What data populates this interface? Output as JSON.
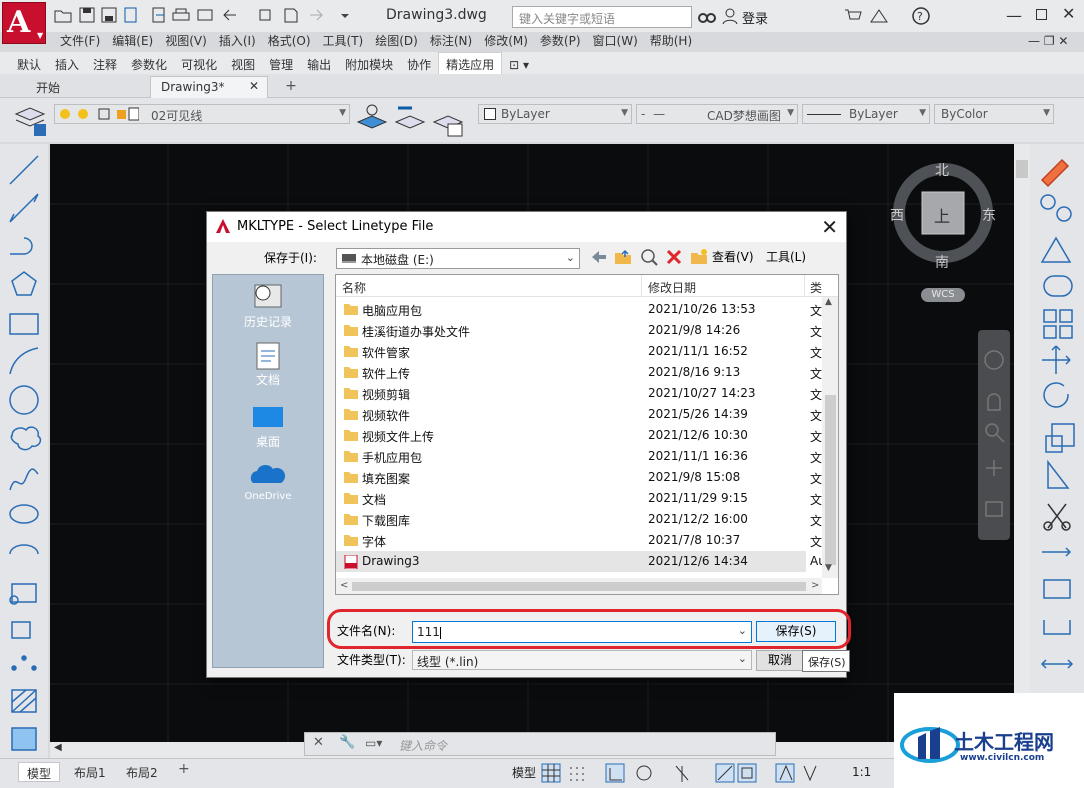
{
  "app": {
    "logo_letter": "A",
    "doc_title": "Drawing3.dwg",
    "search_placeholder": "键入关键字或短语",
    "login": "登录"
  },
  "menu": [
    "文件(F)",
    "编辑(E)",
    "视图(V)",
    "插入(I)",
    "格式(O)",
    "工具(T)",
    "绘图(D)",
    "标注(N)",
    "修改(M)",
    "参数(P)",
    "窗口(W)",
    "帮助(H)"
  ],
  "ribbon_tabs": [
    "默认",
    "插入",
    "注释",
    "参数化",
    "可视化",
    "视图",
    "管理",
    "输出",
    "附加模块",
    "协作",
    "精选应用"
  ],
  "ribbon_selected": "精选应用",
  "doc_tabs": {
    "start": "开始",
    "drawing": "Drawing3*",
    "add": "+"
  },
  "properties": {
    "layer": "02可见线",
    "color": "ByLayer",
    "linetype": "CAD梦想画图",
    "lineweight": "ByLayer",
    "plotstyle": "ByColor"
  },
  "viewcube": {
    "north": "北",
    "south": "南",
    "west": "西",
    "east": "东",
    "face": "上",
    "wcs": "WCS"
  },
  "dialog": {
    "title": "MKLTYPE - Select Linetype File",
    "save_in_label": "保存于(I):",
    "save_in_value": "本地磁盘 (E:)",
    "view_menu": "查看(V)",
    "tools_menu": "工具(L)",
    "places": [
      "历史记录",
      "文档",
      "桌面",
      "OneDrive"
    ],
    "columns": {
      "name": "名称",
      "date": "修改日期",
      "type": "类"
    },
    "files": [
      {
        "name": "电脑应用包",
        "date": "2021/10/26 13:53",
        "type": "文"
      },
      {
        "name": "桂溪街道办事处文件",
        "date": "2021/9/8 14:26",
        "type": "文"
      },
      {
        "name": "软件管家",
        "date": "2021/11/1 16:52",
        "type": "文"
      },
      {
        "name": "软件上传",
        "date": "2021/8/16 9:13",
        "type": "文"
      },
      {
        "name": "视频剪辑",
        "date": "2021/10/27 14:23",
        "type": "文"
      },
      {
        "name": "视频软件",
        "date": "2021/5/26 14:39",
        "type": "文"
      },
      {
        "name": "视频文件上传",
        "date": "2021/12/6 10:30",
        "type": "文"
      },
      {
        "name": "手机应用包",
        "date": "2021/11/1 16:36",
        "type": "文"
      },
      {
        "name": "填充图案",
        "date": "2021/9/8 15:08",
        "type": "文"
      },
      {
        "name": "文档",
        "date": "2021/11/29 9:15",
        "type": "文"
      },
      {
        "name": "下载图库",
        "date": "2021/12/2 16:00",
        "type": "文"
      },
      {
        "name": "字体",
        "date": "2021/7/8 10:37",
        "type": "文"
      },
      {
        "name": "Drawing3",
        "date": "2021/12/6 14:34",
        "type": "Au"
      }
    ],
    "filename_label": "文件名(N):",
    "filename_value": "111",
    "filetype_label": "文件类型(T):",
    "filetype_value": "线型 (*.lin)",
    "save_button": "保存(S)",
    "cancel_button": "取消",
    "tooltip": "保存(S)"
  },
  "command_placeholder": "键入命令",
  "layouts": [
    "模型",
    "布局1",
    "布局2"
  ],
  "status": {
    "model": "模型",
    "scale": "1:1"
  },
  "watermark": {
    "name": "土木工程网",
    "url": "www.civilcn.com"
  }
}
